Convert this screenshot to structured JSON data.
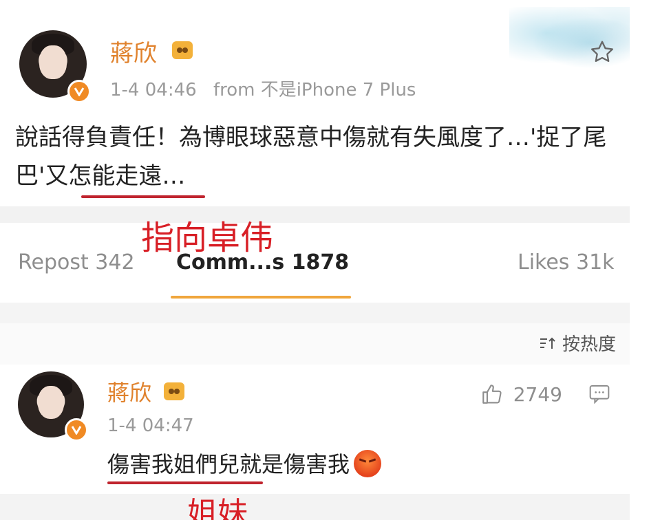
{
  "post": {
    "username": "蔣欣",
    "timestamp": "1-4 04:46",
    "source": "from 不是iPhone 7 Plus",
    "text_part1": "說話得負責任！為博眼球惡意中傷就有失風度了…",
    "text_highlight": "'捉了尾巴'",
    "text_part2": "又怎能走遠…"
  },
  "annotations": {
    "first": "指向卓伟",
    "second": "姐妹"
  },
  "tabs": {
    "repost": "Repost 342",
    "comments": "Comm...s 1878",
    "likes": "Likes 31k"
  },
  "sort": {
    "label": "按热度"
  },
  "comment": {
    "username": "蔣欣",
    "timestamp": "1-4 04:47",
    "text": "傷害我姐們兒就是傷害我",
    "like_count": "2749"
  },
  "colors": {
    "username": "#e0822d",
    "annotation": "#d81f26",
    "tab_indicator": "#f0a63c",
    "verified_badge": "#f08a24"
  },
  "icons": {
    "favorite": "star-icon",
    "verified": "verified-badge-icon",
    "member": "member-icon",
    "sort": "sort-icon",
    "like": "thumbs-up-icon",
    "reply": "comment-icon",
    "emoji": "angry-emoji-icon"
  }
}
